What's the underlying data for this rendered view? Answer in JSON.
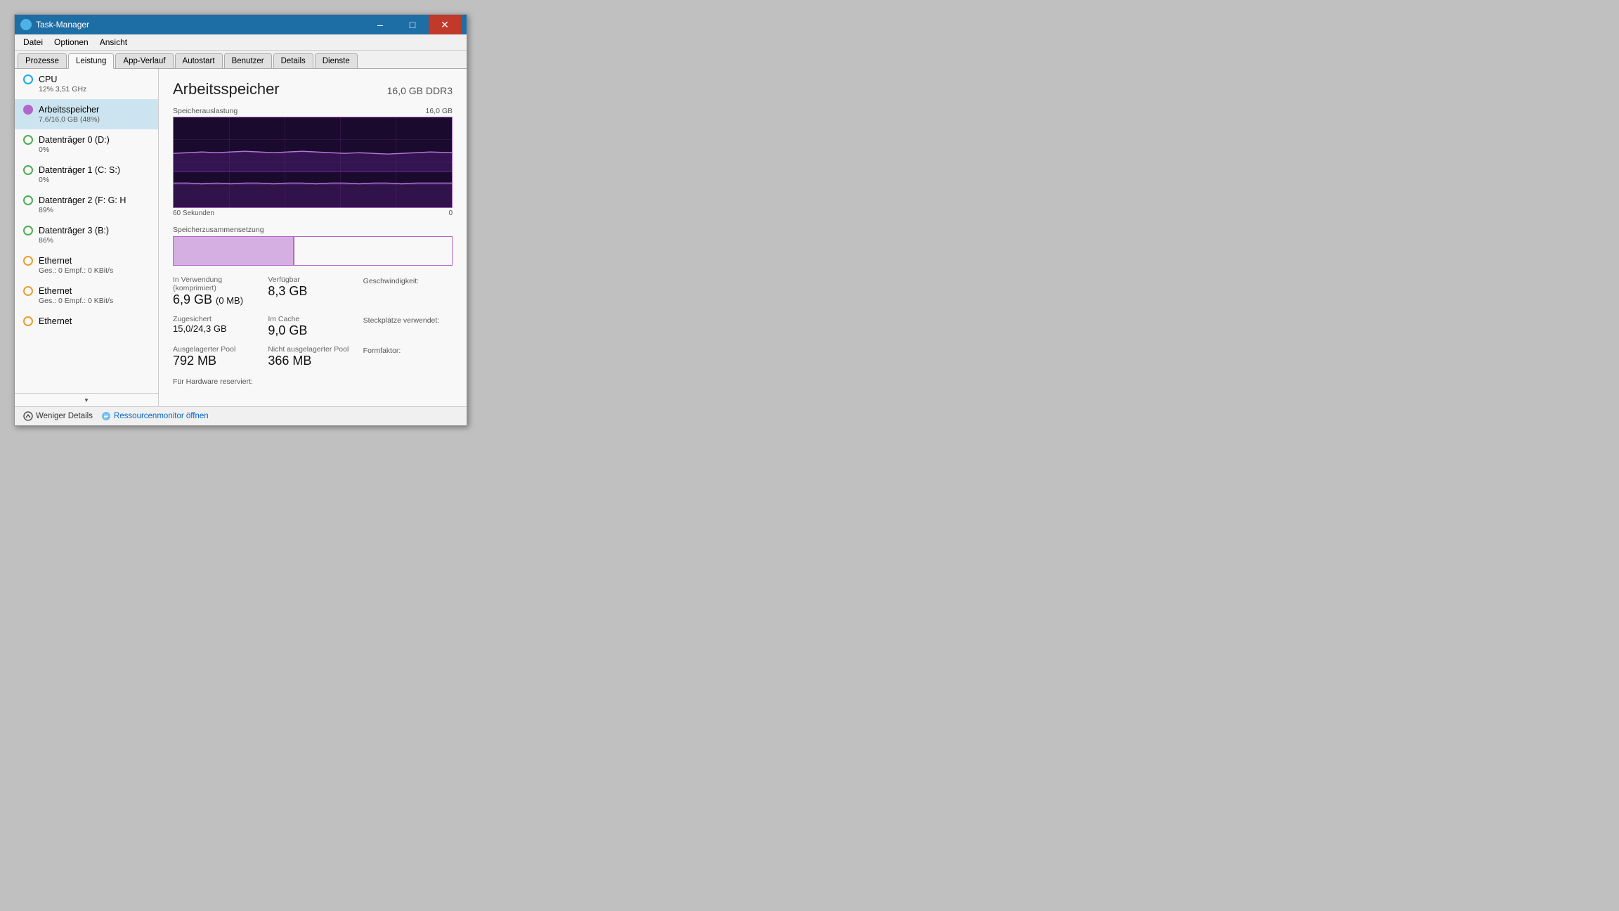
{
  "window": {
    "title": "Task-Manager",
    "icon": "task-manager-icon"
  },
  "menu": {
    "items": [
      "Datei",
      "Optionen",
      "Ansicht"
    ]
  },
  "tabs": [
    {
      "label": "Prozesse",
      "active": false
    },
    {
      "label": "Leistung",
      "active": true
    },
    {
      "label": "App-Verlauf",
      "active": false
    },
    {
      "label": "Autostart",
      "active": false
    },
    {
      "label": "Benutzer",
      "active": false
    },
    {
      "label": "Details",
      "active": false
    },
    {
      "label": "Dienste",
      "active": false
    }
  ],
  "sidebar": {
    "items": [
      {
        "id": "cpu",
        "title": "CPU",
        "subtitle": "12%  3,51 GHz",
        "dot_color": "#1ca8e8",
        "dot_border": "#1ca8e8",
        "active": false
      },
      {
        "id": "arbeitsspeicher",
        "title": "Arbeitsspeicher",
        "subtitle": "7,6/16,0 GB (48%)",
        "dot_color": "#b366cc",
        "dot_border": "#b366cc",
        "active": true
      },
      {
        "id": "datentraeger0",
        "title": "Datenträger 0 (D:)",
        "subtitle": "0%",
        "dot_color": "transparent",
        "dot_border": "#4caf50",
        "active": false
      },
      {
        "id": "datentraeger1",
        "title": "Datenträger 1 (C: S:)",
        "subtitle": "0%",
        "dot_color": "transparent",
        "dot_border": "#4caf50",
        "active": false
      },
      {
        "id": "datentraeger2",
        "title": "Datenträger 2 (F: G: H",
        "subtitle": "89%",
        "dot_color": "transparent",
        "dot_border": "#4caf50",
        "active": false
      },
      {
        "id": "datentraeger3",
        "title": "Datenträger 3 (B:)",
        "subtitle": "86%",
        "dot_color": "transparent",
        "dot_border": "#4caf50",
        "active": false
      },
      {
        "id": "ethernet1",
        "title": "Ethernet",
        "subtitle": "Ges.: 0  Empf.: 0 KBit/s",
        "dot_color": "transparent",
        "dot_border": "#e8a030",
        "active": false
      },
      {
        "id": "ethernet2",
        "title": "Ethernet",
        "subtitle": "Ges.: 0  Empf.: 0 KBit/s",
        "dot_color": "transparent",
        "dot_border": "#e8a030",
        "active": false
      },
      {
        "id": "ethernet3",
        "title": "Ethernet",
        "subtitle": "",
        "dot_color": "transparent",
        "dot_border": "#e8a030",
        "active": false
      }
    ]
  },
  "main": {
    "title": "Arbeitsspeicher",
    "spec": "16,0 GB DDR3",
    "graph": {
      "label_left": "Speicherauslastung",
      "label_right": "16,0 GB",
      "label_bottom_left": "60 Sekunden",
      "label_bottom_right": "0",
      "time_label": "60 Sekunden",
      "zero_label": "0"
    },
    "composition": {
      "label": "Speicherzusammensetzung"
    },
    "stats": [
      {
        "label": "In Verwendung (komprimiert)",
        "value": "6,9 GB",
        "sub": "(0 MB)"
      },
      {
        "label": "Verfügbar",
        "value": "8,3 GB",
        "sub": ""
      },
      {
        "label": "Geschwindigkeit:",
        "value": "",
        "sub": ""
      },
      {
        "label": "Zugesichert",
        "value": "15,0/24,3 GB",
        "sub": ""
      },
      {
        "label": "Im Cache",
        "value": "9,0 GB",
        "sub": ""
      },
      {
        "label": "Steckplätze verwendet:",
        "value": "",
        "sub": ""
      },
      {
        "label": "Ausgelagerter Pool",
        "value": "792 MB",
        "sub": ""
      },
      {
        "label": "Nicht ausgelagerter Pool",
        "value": "366 MB",
        "sub": ""
      },
      {
        "label": "Formfaktor:",
        "value": "",
        "sub": ""
      },
      {
        "label": "Für Hardware reserviert:",
        "value": "",
        "sub": ""
      }
    ]
  },
  "footer": {
    "less_details": "Weniger Details",
    "resource_monitor": "Ressourcenmonitor öffnen"
  }
}
